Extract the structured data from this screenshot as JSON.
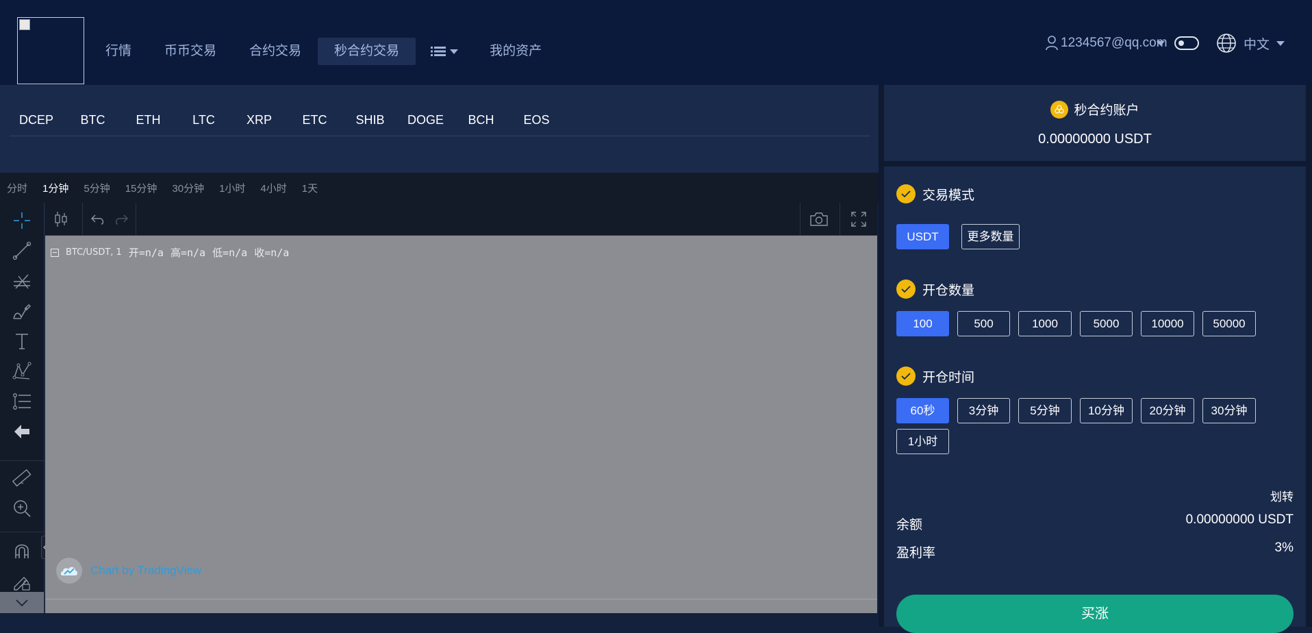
{
  "header": {
    "nav": [
      "行情",
      "币币交易",
      "合约交易",
      "秒合约交易"
    ],
    "nav_active_index": 3,
    "assets_label": "我的资产",
    "user_email": "1234567@qq.com",
    "language": "中文"
  },
  "coins": [
    "DCEP",
    "BTC",
    "ETH",
    "LTC",
    "XRP",
    "ETC",
    "SHIB",
    "DOGE",
    "BCH",
    "EOS"
  ],
  "intervals": [
    "分时",
    "1分钟",
    "5分钟",
    "15分钟",
    "30分钟",
    "1小时",
    "4小时",
    "1天"
  ],
  "interval_active_index": 1,
  "chart": {
    "symbol": "BTC/USDT, 1",
    "open": "开=n/a",
    "high": "高=n/a",
    "low": "低=n/a",
    "close": "收=n/a",
    "attribution": "Chart by TradingView"
  },
  "account": {
    "title": "秒合约账户",
    "balance": "0.00000000 USDT"
  },
  "trade": {
    "mode_title": "交易模式",
    "modes": [
      "USDT",
      "更多数量"
    ],
    "mode_active_index": 0,
    "quantity_title": "开仓数量",
    "quantities": [
      "100",
      "500",
      "1000",
      "5000",
      "10000",
      "50000"
    ],
    "quantity_active_index": 0,
    "time_title": "开仓时间",
    "times": [
      "60秒",
      "3分钟",
      "5分钟",
      "10分钟",
      "20分钟",
      "30分钟",
      "1小时"
    ],
    "time_active_index": 0,
    "transfer": "划转",
    "balance_label": "余额",
    "balance_value": "0.00000000 USDT",
    "profit_label": "盈利率",
    "profit_value": "3%",
    "buy_label": "买涨"
  },
  "colors": {
    "accent": "#3a6cf4",
    "buy": "#13a585",
    "gold": "#f1b80d"
  }
}
